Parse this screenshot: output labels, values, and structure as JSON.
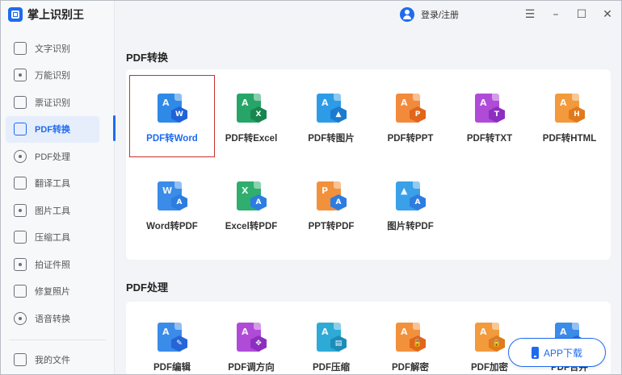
{
  "app": {
    "title": "掌上识别王"
  },
  "topbar": {
    "login_label": "登录/注册"
  },
  "sidebar": {
    "items": [
      {
        "label": "文字识别",
        "icon": "text-recognition-icon"
      },
      {
        "label": "万能识别",
        "icon": "camera-icon"
      },
      {
        "label": "票证识别",
        "icon": "ticket-icon"
      },
      {
        "label": "PDF转换",
        "icon": "pdf-convert-icon",
        "active": true
      },
      {
        "label": "PDF处理",
        "icon": "pdf-process-icon"
      },
      {
        "label": "翻译工具",
        "icon": "translate-icon"
      },
      {
        "label": "图片工具",
        "icon": "image-icon"
      },
      {
        "label": "压缩工具",
        "icon": "compress-icon"
      },
      {
        "label": "拍证件照",
        "icon": "id-photo-icon"
      },
      {
        "label": "修复照片",
        "icon": "photo-repair-icon"
      },
      {
        "label": "语音转换",
        "icon": "voice-icon"
      }
    ],
    "bottom": {
      "label": "我的文件",
      "icon": "my-files-icon"
    }
  },
  "sections": [
    {
      "title": "PDF转换",
      "tools": [
        {
          "label": "PDF转Word",
          "color": "#2e8ae6",
          "badge_color": "#2062d8",
          "glyph": "A",
          "badge": "W",
          "selected": true
        },
        {
          "label": "PDF转Excel",
          "color": "#27a568",
          "badge_color": "#17864f",
          "glyph": "A",
          "badge": "X"
        },
        {
          "label": "PDF转图片",
          "color": "#2e9be6",
          "badge_color": "#1a7bd0",
          "glyph": "A",
          "badge": "▲"
        },
        {
          "label": "PDF转PPT",
          "color": "#f28a3c",
          "badge_color": "#e0661c",
          "glyph": "A",
          "badge": "P"
        },
        {
          "label": "PDF转TXT",
          "color": "#b04bd8",
          "badge_color": "#8c2fc0",
          "glyph": "A",
          "badge": "T"
        },
        {
          "label": "PDF转HTML",
          "color": "#f29a3c",
          "badge_color": "#e07a1c",
          "glyph": "A",
          "badge": "H"
        },
        {
          "label": "Word转PDF",
          "color": "#3b8be8",
          "badge_color": "#2d7de0",
          "glyph": "W",
          "badge": "A"
        },
        {
          "label": "Excel转PDF",
          "color": "#2fae6e",
          "badge_color": "#2d7de0",
          "glyph": "X",
          "badge": "A"
        },
        {
          "label": "PPT转PDF",
          "color": "#f2913c",
          "badge_color": "#2d7de0",
          "glyph": "P",
          "badge": "A"
        },
        {
          "label": "图片转PDF",
          "color": "#3aa0e8",
          "badge_color": "#2d7de0",
          "glyph": "▲",
          "badge": "A"
        }
      ]
    },
    {
      "title": "PDF处理",
      "tools": [
        {
          "label": "PDF编辑",
          "color": "#3b8be8",
          "badge_color": "#2466d8",
          "glyph": "A",
          "badge": "✎"
        },
        {
          "label": "PDF调方向",
          "color": "#b04bd8",
          "badge_color": "#8c2fc0",
          "glyph": "A",
          "badge": "✥"
        },
        {
          "label": "PDF压缩",
          "color": "#2eaad6",
          "badge_color": "#1d8cb8",
          "glyph": "A",
          "badge": "▤"
        },
        {
          "label": "PDF解密",
          "color": "#f2913c",
          "badge_color": "#e0661c",
          "glyph": "A",
          "badge": "🔓"
        },
        {
          "label": "PDF加密",
          "color": "#f29a3c",
          "badge_color": "#e07a1c",
          "glyph": "A",
          "badge": "🔒"
        },
        {
          "label": "PDF合并",
          "color": "#3b8be8",
          "badge_color": "#2466d8",
          "glyph": "A",
          "badge": "⊕"
        }
      ]
    }
  ],
  "app_download": {
    "label": "APP下载"
  }
}
